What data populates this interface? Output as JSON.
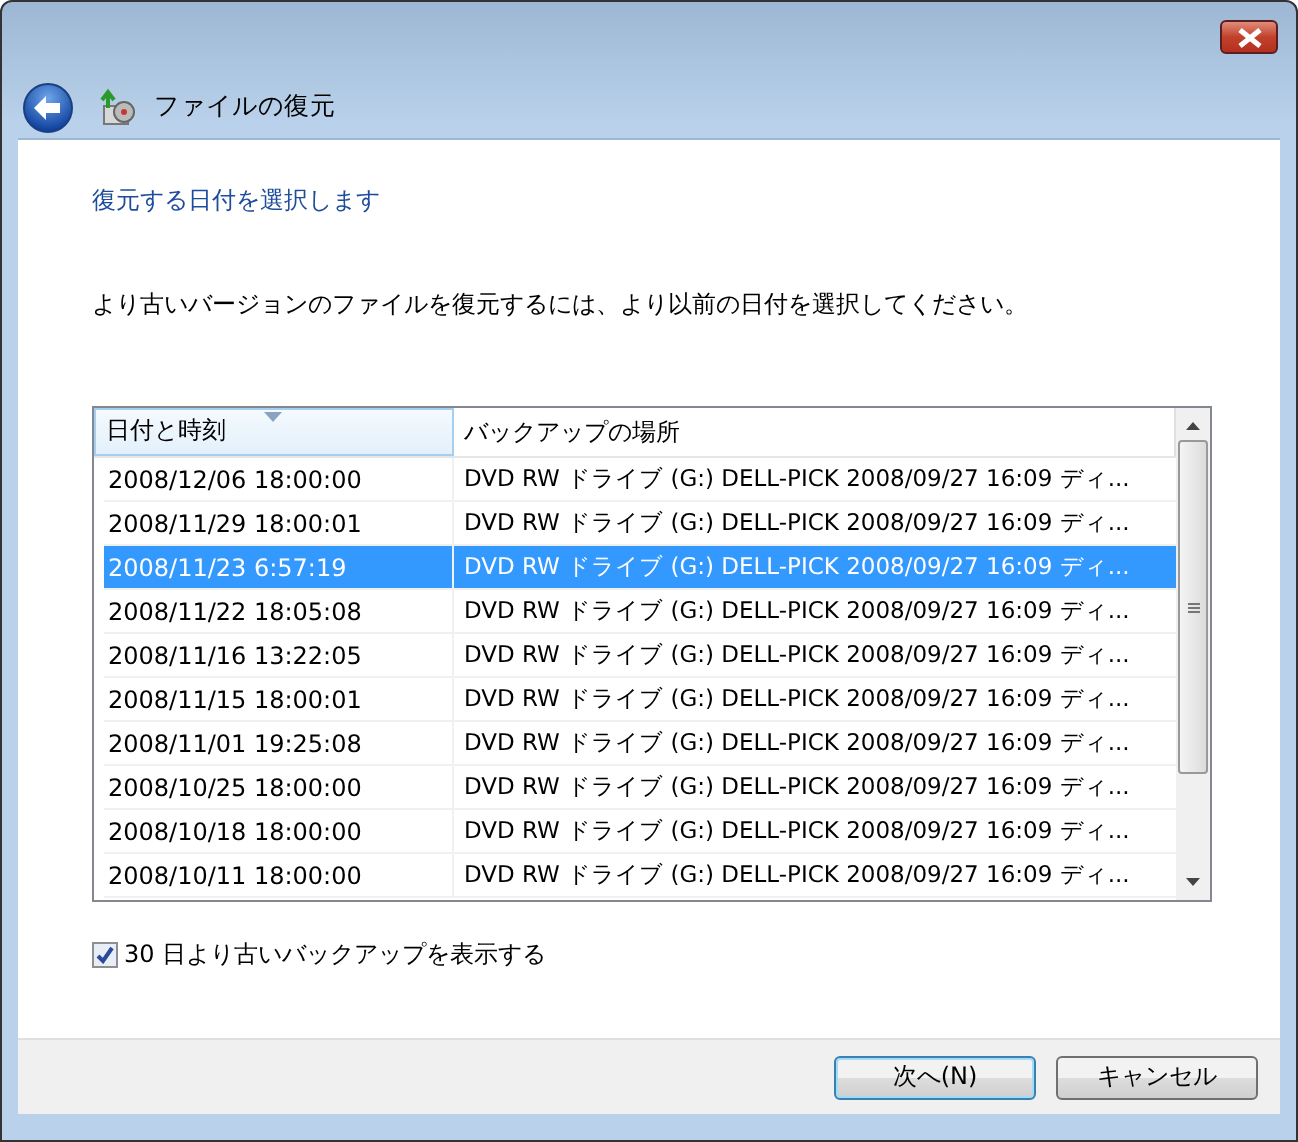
{
  "window": {
    "title": "ファイルの復元"
  },
  "heading": "復元する日付を選択します",
  "instruction": "より古いバージョンのファイルを復元するには、より以前の日付を選択してください。",
  "table": {
    "columns": [
      {
        "label": "日付と時刻",
        "sorted": true
      },
      {
        "label": "バックアップの場所",
        "sorted": false
      }
    ],
    "rows": [
      {
        "date": "2008/12/06 18:00:00",
        "location": "DVD RW ドライブ (G:) DELL-PICK 2008/09/27 16:09 ディ...",
        "selected": false
      },
      {
        "date": "2008/11/29 18:00:01",
        "location": "DVD RW ドライブ (G:) DELL-PICK 2008/09/27 16:09 ディ...",
        "selected": false
      },
      {
        "date": "2008/11/23 6:57:19",
        "location": "DVD RW ドライブ (G:) DELL-PICK 2008/09/27 16:09 ディ...",
        "selected": true
      },
      {
        "date": "2008/11/22 18:05:08",
        "location": "DVD RW ドライブ (G:) DELL-PICK 2008/09/27 16:09 ディ...",
        "selected": false
      },
      {
        "date": "2008/11/16 13:22:05",
        "location": "DVD RW ドライブ (G:) DELL-PICK 2008/09/27 16:09 ディ...",
        "selected": false
      },
      {
        "date": "2008/11/15 18:00:01",
        "location": "DVD RW ドライブ (G:) DELL-PICK 2008/09/27 16:09 ディ...",
        "selected": false
      },
      {
        "date": "2008/11/01 19:25:08",
        "location": "DVD RW ドライブ (G:) DELL-PICK 2008/09/27 16:09 ディ...",
        "selected": false
      },
      {
        "date": "2008/10/25 18:00:00",
        "location": "DVD RW ドライブ (G:) DELL-PICK 2008/09/27 16:09 ディ...",
        "selected": false
      },
      {
        "date": "2008/10/18 18:00:00",
        "location": "DVD RW ドライブ (G:) DELL-PICK 2008/09/27 16:09 ディ...",
        "selected": false
      },
      {
        "date": "2008/10/11 18:00:00",
        "location": "DVD RW ドライブ (G:) DELL-PICK 2008/09/27 16:09 ディ...",
        "selected": false
      }
    ]
  },
  "show_older": {
    "label": "30 日より古いバックアップを表示する",
    "checked": true
  },
  "buttons": [
    {
      "label": "次へ(N)",
      "default": true
    },
    {
      "label": "キャンセル",
      "default": false
    }
  ]
}
